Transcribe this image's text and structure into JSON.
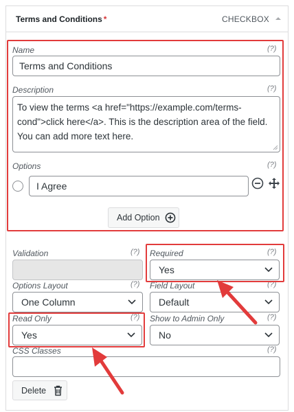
{
  "panel": {
    "title": "Terms and Conditions",
    "required_star": "*",
    "type": "CHECKBOX"
  },
  "help_text": "(?)",
  "name": {
    "label": "Name",
    "value": "Terms and Conditions"
  },
  "description": {
    "label": "Description",
    "value": "To view the terms <a href=\"https://example.com/terms-cond\">click here</a>. This is the description area of the field. You can add more text here."
  },
  "options": {
    "label": "Options",
    "items": [
      {
        "value": "I Agree"
      }
    ],
    "add_button": "Add Option"
  },
  "validation": {
    "label": "Validation",
    "value": ""
  },
  "required": {
    "label": "Required",
    "value": "Yes"
  },
  "options_layout": {
    "label": "Options Layout",
    "value": "One Column"
  },
  "field_layout": {
    "label": "Field Layout",
    "value": "Default"
  },
  "read_only": {
    "label": "Read Only",
    "value": "Yes"
  },
  "show_to_admin": {
    "label": "Show to Admin Only",
    "value": "No"
  },
  "css_classes": {
    "label": "CSS Classes",
    "value": ""
  },
  "delete_button": "Delete",
  "colors": {
    "highlight": "#e23b3b",
    "border": "#8c8f94"
  }
}
